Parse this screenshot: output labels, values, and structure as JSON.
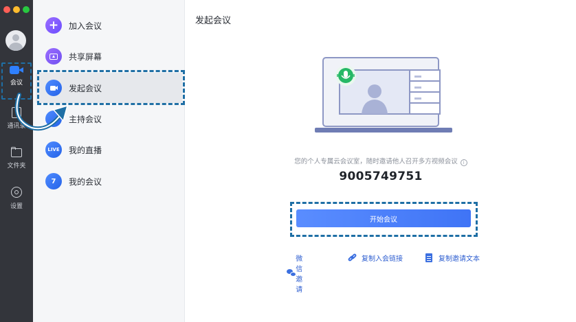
{
  "rail": {
    "items": [
      {
        "label": "会议",
        "icon": "video-camera-icon",
        "active": true
      },
      {
        "label": "通讯录",
        "icon": "contacts-icon"
      },
      {
        "label": "文件夹",
        "icon": "folder-icon"
      },
      {
        "label": "设置",
        "icon": "settings-icon"
      }
    ]
  },
  "menu": {
    "items": [
      {
        "label": "加入会议",
        "icon": "plus-icon"
      },
      {
        "label": "共享屏幕",
        "icon": "share-screen-icon"
      },
      {
        "label": "发起会议",
        "icon": "video-camera-icon",
        "active": true
      },
      {
        "label": "主持会议",
        "icon": "host-icon"
      },
      {
        "label": "我的直播",
        "icon": "live-icon",
        "badge": "LIVE"
      },
      {
        "label": "我的会议",
        "icon": "calendar-icon",
        "badge": "7"
      }
    ]
  },
  "main": {
    "title": "发起会议",
    "description": "您的个人专属云会议室，随时邀请他人召开多方视频会议",
    "info_icon": "i",
    "meeting_id": "9005749751",
    "start_button": "开始会议",
    "actions": [
      {
        "label": "微信邀请",
        "icon": "wechat-icon"
      },
      {
        "label": "复制入会链接",
        "icon": "link-icon"
      },
      {
        "label": "复制邀请文本",
        "icon": "document-icon"
      }
    ]
  },
  "colors": {
    "rail_bg": "#33353b",
    "accent": "#3f74f6",
    "annotation_dash": "#1f6fa5"
  }
}
